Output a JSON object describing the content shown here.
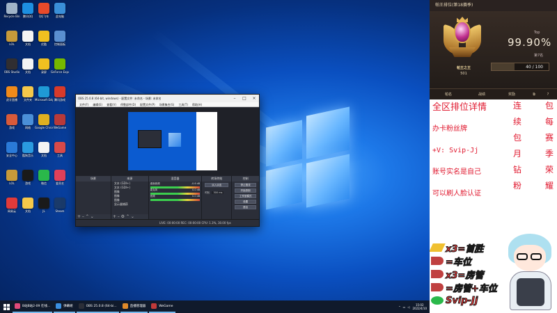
{
  "desktop": {
    "icons": [
      {
        "label": "Recycle Bin",
        "color": "#9fb3c8"
      },
      {
        "label": "腾讯QQ",
        "color": "#1d8fe0"
      },
      {
        "label": "QQ飞车",
        "color": "#e84a2a"
      },
      {
        "label": "此电脑",
        "color": "#3a8fd8"
      },
      {
        "label": "LOL",
        "color": "#c79a3a"
      },
      {
        "label": "文档",
        "color": "#f4f4f4"
      },
      {
        "label": "优酷",
        "color": "#f0c020"
      },
      {
        "label": "控制面板",
        "color": "#5a8fd0"
      },
      {
        "label": "OBS Studio",
        "color": "#302e31"
      },
      {
        "label": "文档",
        "color": "#f4f4f4"
      },
      {
        "label": "录屏",
        "color": "#f0c020"
      },
      {
        "label": "GeForce Experience",
        "color": "#76b900"
      },
      {
        "label": "虎牙直播",
        "color": "#f08a1a"
      },
      {
        "label": "文件夹",
        "color": "#f5c84a"
      },
      {
        "label": "Microsoft Edge",
        "color": "#1f9ad6"
      },
      {
        "label": "腾讯游戏",
        "color": "#d83a2a"
      },
      {
        "label": "游戏",
        "color": "#d85a3a"
      },
      {
        "label": "网络",
        "color": "#4a8fd8"
      },
      {
        "label": "Google Chrome",
        "color": "#e0b020"
      },
      {
        "label": "WeGame",
        "color": "#b83a3a"
      },
      {
        "label": "安全中心",
        "color": "#2a7ad8"
      },
      {
        "label": "酷狗音乐",
        "color": "#2a9ae0"
      },
      {
        "label": "文档",
        "color": "#f4f4f4"
      },
      {
        "label": "工具",
        "color": "#d84a4a"
      },
      {
        "label": "LOL",
        "color": "#c79a3a"
      },
      {
        "label": "游戏",
        "color": "#1a1a1a"
      },
      {
        "label": "微信",
        "color": "#2ab84a"
      },
      {
        "label": "爱奇艺",
        "color": "#e0405a"
      },
      {
        "label": "网易云",
        "color": "#e03a3a"
      },
      {
        "label": "文档",
        "color": "#f5c84a"
      },
      {
        "label": "JL",
        "color": "#1a1a1a"
      },
      {
        "label": "Steam",
        "color": "#1a3a6a"
      }
    ]
  },
  "obs": {
    "title": "OBS 25.0.8 (64-bit, windows) - 配置文件: 未命名 - 场景: 未命名",
    "menu": [
      "文件(F)",
      "编辑(E)",
      "查看(V)",
      "停靠部件(D)",
      "配置文件(P)",
      "场景集合(S)",
      "工具(T)",
      "帮助(H)"
    ],
    "docks": {
      "scenes": "场景",
      "sources": "来源",
      "mixer": "混音器",
      "transitions": "转场特效",
      "controls": "控制"
    },
    "sources": [
      "文本 (GDI+)",
      "文本 (GDI+)",
      "图像",
      "图像",
      "图像",
      "显示器捕获"
    ],
    "mixer": [
      {
        "name": "桌面音频",
        "db": "-0.6 dB"
      },
      {
        "name": "麦克风",
        "db": "0.0 dB"
      },
      {
        "name": "音频",
        "db": "0.0 dB"
      }
    ],
    "transition": {
      "name": "淡入淡出",
      "duration_label": "时长",
      "duration": "300 ms"
    },
    "controls": [
      "停止推流",
      "开始录制",
      "工作室模式",
      "设置",
      "退出"
    ],
    "status": "LIVE: 00:00:00   REC: 00:00:00   CPU: 1.3%, 30.00 fps"
  },
  "taskbar": {
    "apps": [
      {
        "label": "B站B站2-09 在线...",
        "color": "#e04a7a"
      },
      {
        "label": "弹幕姬",
        "color": "#3a8fe0"
      },
      {
        "label": "OBS 25.0.8 (64-bi...",
        "color": "#2b2e38"
      },
      {
        "label": "直播管理器",
        "color": "#e08a2a"
      },
      {
        "label": "WeGame",
        "color": "#c03a3a"
      }
    ],
    "time": "15:02",
    "date": "2022/4/10"
  },
  "overlay": {
    "rank_title": "帕王排位(第18赛季)",
    "rank_name": "帕王之王",
    "rank_stars": "501",
    "top_label": "Top",
    "top_percent": "99.90%",
    "top_place": "第7名",
    "progress": {
      "value": 40,
      "max": 100,
      "label": "40 / 100"
    },
    "tabs": [
      "帕名",
      "战绩",
      "奖励",
      "",
      "?"
    ],
    "promo_lines": [
      "全区排位详情",
      "办卡粉丝牌",
      "+V: Svip-Jj",
      "账号实名是自己",
      "可以刷人脸认证"
    ],
    "vertical_col1": [
      "连",
      "续",
      "包",
      "月",
      "钻",
      "粉"
    ],
    "vertical_col2": [
      "包",
      "每",
      "赛",
      "季",
      "荣",
      "耀"
    ],
    "badges": [
      {
        "text": "x3=首胜",
        "color": "#f0c030"
      },
      {
        "text": "=车位",
        "color": "#c04040"
      },
      {
        "text": "x3=房管",
        "color": "#c04040"
      },
      {
        "text": "=房管+车位",
        "color": "#c04040"
      },
      {
        "text": "Svip-Jj",
        "color": "#2ab84a"
      }
    ]
  }
}
